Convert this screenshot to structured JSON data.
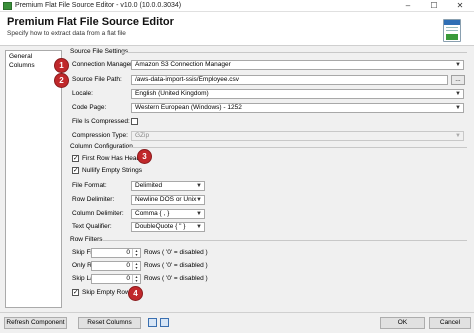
{
  "window": {
    "title": "Premium Flat File Source Editor - v10.0 (10.0.0.3034)",
    "minimize": "–",
    "maximize": "☐",
    "close": "✕"
  },
  "header": {
    "title": "Premium Flat File Source Editor",
    "subtitle": "Specify how to extract data from a flat file"
  },
  "sidebar": {
    "items": [
      {
        "label": "General"
      },
      {
        "label": "Columns"
      }
    ]
  },
  "source": {
    "section": "Source File Settings",
    "connection_manager": {
      "label": "Connection Manager:",
      "value": "Amazon S3 Connection Manager"
    },
    "source_file_path": {
      "label": "Source File Path:",
      "value": "/aws-data-import-ssis/Employee.csv",
      "browse": "..."
    },
    "locale": {
      "label": "Locale:",
      "value": "English (United Kingdom)"
    },
    "code_page": {
      "label": "Code Page:",
      "value": "Western European (Windows) - 1252"
    },
    "file_is_compressed": {
      "label": "File Is Compressed:",
      "checked": false
    },
    "compression_type": {
      "label": "Compression Type:",
      "value": "GZip"
    }
  },
  "column_config": {
    "section": "Column Configuration",
    "first_row_header": {
      "label": "First Row Has Header",
      "checked": true
    },
    "nullify_empty": {
      "label": "Nullify Empty Strings",
      "checked": true
    },
    "file_format": {
      "label": "File Format:",
      "value": "Delimited"
    },
    "row_delimiter": {
      "label": "Row Delimiter:",
      "value": "Newline DOS or Unix"
    },
    "column_delimiter": {
      "label": "Column Delimiter:",
      "value": "Comma { , }"
    },
    "text_qualifier": {
      "label": "Text Qualifier:",
      "value": "DoubleQuote { \" }"
    }
  },
  "row_filters": {
    "section": "Row Filters",
    "skip_first": {
      "label": "Skip First",
      "value": "0",
      "suffix": "Rows ( '0' = disabled )"
    },
    "only_read": {
      "label": "Only Read",
      "value": "0",
      "suffix": "Rows ( '0' = disabled )"
    },
    "skip_last": {
      "label": "Skip Last",
      "value": "0",
      "suffix": "Rows ( '0' = disabled )"
    },
    "skip_empty": {
      "label": "Skip Empty Rows",
      "checked": true
    }
  },
  "badges": [
    "1",
    "2",
    "3",
    "4"
  ],
  "footer": {
    "refresh": "Refresh Component",
    "reset": "Reset Columns",
    "ok": "OK",
    "cancel": "Cancel"
  },
  "colors": {
    "badge": "#c0282b",
    "accent": "#2f6fb5"
  }
}
